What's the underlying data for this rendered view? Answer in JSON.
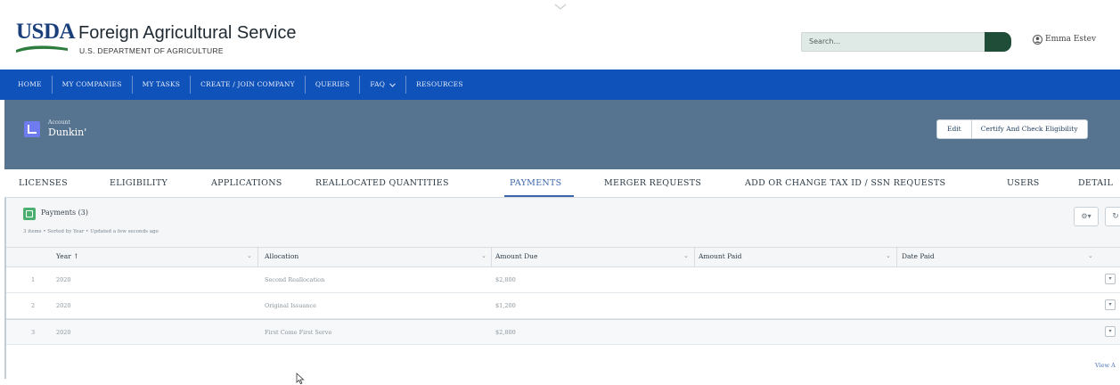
{
  "header": {
    "logo_text": "USDA",
    "agency_name": "Foreign Agricultural Service",
    "department": "U.S. DEPARTMENT OF AGRICULTURE",
    "search_placeholder": "Search...",
    "user_name": "Emma Estev"
  },
  "nav": {
    "items": [
      "HOME",
      "MY COMPANIES",
      "MY TASKS",
      "CREATE / JOIN COMPANY",
      "QUERIES",
      "FAQ",
      "RESOURCES"
    ]
  },
  "record": {
    "type_label": "Account",
    "name": "Dunkin'",
    "edit_label": "Edit",
    "certify_label": "Certify And Check Eligibility"
  },
  "tabs": {
    "items": [
      "LICENSES",
      "ELIGIBILITY",
      "APPLICATIONS",
      "REALLOCATED QUANTITIES",
      "PAYMENTS",
      "MERGER REQUESTS",
      "ADD OR CHANGE TAX ID / SSN REQUESTS",
      "USERS",
      "DETAIL"
    ],
    "active": "PAYMENTS"
  },
  "payments": {
    "title": "Payments (3)",
    "meta": "3 items • Sorted by Year • Updated a few seconds ago",
    "columns": [
      "Year ↑",
      "Allocation",
      "Amount Due",
      "Amount Paid",
      "Date Paid"
    ],
    "rows": [
      {
        "num": "1",
        "year": "2020",
        "allocation": "Second Reallocation",
        "amount_due": "$2,800",
        "amount_paid": "",
        "date_paid": ""
      },
      {
        "num": "2",
        "year": "2020",
        "allocation": "Original Issuance",
        "amount_due": "$1,200",
        "amount_paid": "",
        "date_paid": ""
      },
      {
        "num": "3",
        "year": "2020",
        "allocation": "First Come First Serve",
        "amount_due": "$2,800",
        "amount_paid": "",
        "date_paid": ""
      }
    ],
    "view_all": "View A"
  },
  "colors": {
    "nav_blue": "#0f52ba",
    "record_slate": "#56748f",
    "search_button": "#1f4d38",
    "tab_active": "#3b66a8",
    "usda_blue": "#1a3f7a",
    "usda_green": "#2e7d3e"
  },
  "icons": {
    "nav_dropdown": "chevron-down-icon",
    "record": "account-icon",
    "list": "payments-icon",
    "settings": "gear-icon",
    "refresh": "refresh-icon",
    "user": "user-icon",
    "row_action": "dropdown-icon"
  }
}
